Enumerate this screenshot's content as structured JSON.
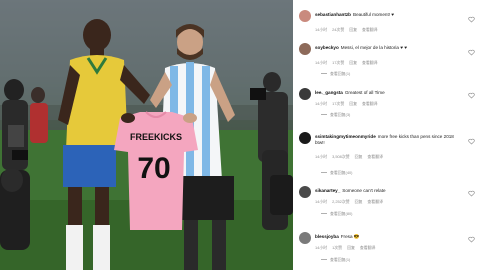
{
  "photo": {
    "jersey_text": "FREEKICKS",
    "jersey_number": "70"
  },
  "comments": [
    {
      "username": "sebastianhantzb",
      "text": "Beautiful moment! ♥",
      "time": "14小时",
      "likes": "24次赞",
      "reply": "回复",
      "translate": "查看翻译",
      "avatar_color": "#c98a7e"
    },
    {
      "username": "soybeckyo",
      "text": "Messi, el mejor de la historia ♥ ♥",
      "time": "14小时",
      "likes": "17次赞",
      "reply": "回复",
      "translate": "查看翻译",
      "avatar_color": "#8d6a5a",
      "view_replies": "查看回复(1)"
    },
    {
      "username": "lee._gangsta",
      "text": "Greatest of all Time",
      "time": "14小时",
      "likes": "17次赞",
      "reply": "回复",
      "translate": "查看翻译",
      "avatar_color": "#3a3a3a",
      "view_replies": "查看回复(3)"
    },
    {
      "username": "ssimtakingmytimeonmyride",
      "text": "more free kicks than pens since 2018 btw!!",
      "time": "14小时",
      "likes": "3,508次赞",
      "reply": "回复",
      "translate": "查看翻译",
      "avatar_color": "#1a1a1a",
      "view_replies": "查看回复(40)"
    },
    {
      "username": "sikanartey_",
      "text": "Someone can't relate",
      "time": "14小时",
      "likes": "2,252次赞",
      "reply": "回复",
      "translate": "查看翻译",
      "avatar_color": "#4a4a4a",
      "view_replies": "查看回复(80)"
    },
    {
      "username": "blessjoyba",
      "text": "Fresa 😎",
      "time": "14小时",
      "likes": "1次赞",
      "reply": "回复",
      "translate": "查看翻译",
      "avatar_color": "#7a7a7a",
      "view_replies": "查看回复(1)"
    }
  ]
}
